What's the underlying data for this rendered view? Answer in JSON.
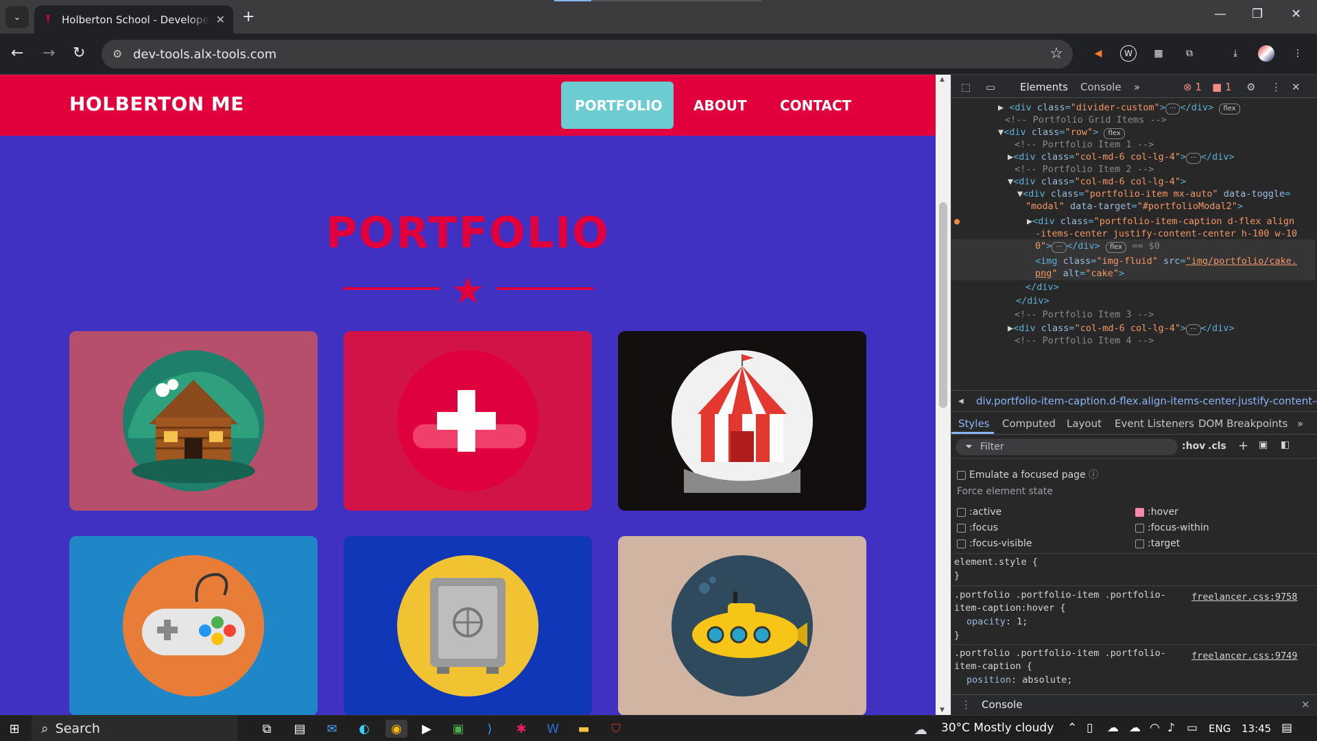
{
  "browser": {
    "tab_title": "Holberton School - Developer t",
    "url": "dev-tools.alx-tools.com",
    "new_tab": "+",
    "close_tab": "✕"
  },
  "page": {
    "brand": "HOLBERTON ME",
    "nav": [
      "PORTFOLIO",
      "ABOUT",
      "CONTACT"
    ],
    "heading": "PORTFOLIO",
    "cards": [
      {
        "name": "cabin",
        "bg": "#b64f6c"
      },
      {
        "name": "cake",
        "bg": "#d11347"
      },
      {
        "name": "circus",
        "bg": "#140f0f"
      },
      {
        "name": "game",
        "bg": "#1f86c8"
      },
      {
        "name": "safe",
        "bg": "#0f37b7"
      },
      {
        "name": "submarine",
        "bg": "#d1b4a2"
      }
    ]
  },
  "devtools": {
    "tabs": [
      "Elements",
      "Console"
    ],
    "error_count": "1",
    "issue_count": "1",
    "dom_lines": [
      {
        "indent": 1,
        "arrow": "▶",
        "html": "<div class=\"divider-custom\">",
        "tail": "</div>",
        "badge": "flex"
      },
      {
        "indent": 1,
        "comment": "<!-- Portfolio Grid Items -->"
      },
      {
        "indent": 0,
        "arrow": "▼",
        "html": "<div class=\"row\">",
        "badge": "flex"
      },
      {
        "indent": 2,
        "comment": "<!-- Portfolio Item 1 -->"
      },
      {
        "indent": 2,
        "arrow": "▶",
        "html": "<div class=\"col-md-6 col-lg-4\">",
        "tail": "</div>"
      },
      {
        "indent": 2,
        "comment": "<!-- Portfolio Item 2 -->"
      },
      {
        "indent": 2,
        "arrow": "▼",
        "html": "<div class=\"col-md-6 col-lg-4\">"
      }
    ],
    "breadcrumb": "div.portfolio-item-caption.d-flex.align-items-center.justify-content-cen",
    "style_tabs": [
      "Styles",
      "Computed",
      "Layout",
      "Event Listeners",
      "DOM Breakpoints"
    ],
    "filter_placeholder": "Filter",
    "hov": ":hov",
    "cls": ".cls",
    "emulate_focus": "Emulate a focused page",
    "force_state_title": "Force element state",
    "states": [
      {
        "label": ":active",
        "checked": false
      },
      {
        "label": ":hover",
        "checked": true
      },
      {
        "label": ":focus",
        "checked": false
      },
      {
        "label": ":focus-within",
        "checked": false
      },
      {
        "label": ":focus-visible",
        "checked": false
      },
      {
        "label": ":target",
        "checked": false
      }
    ],
    "element_style": "element.style {",
    "close_brace": "}",
    "rule1_selector_a": ".portfolio .portfolio-item .portfolio-",
    "rule1_selector_b": "item-caption:hover {",
    "rule1_prop": "opacity",
    "rule1_value": "1;",
    "rule1_link": "freelancer.css:9758",
    "rule2_selector_a": ".portfolio .portfolio-item .portfolio-",
    "rule2_selector_b": "item-caption {",
    "rule2_prop": "position",
    "rule2_value": "absolute;",
    "rule2_link": "freelancer.css:9749",
    "console_label": "Console"
  },
  "taskbar": {
    "search": "Search",
    "weather": "30°C  Mostly cloudy",
    "lang": "ENG",
    "time": "13:45"
  },
  "colors": {
    "navbar": "#e1003c",
    "page_bg": "#4131c2",
    "active_nav": "#6dcbd2"
  }
}
